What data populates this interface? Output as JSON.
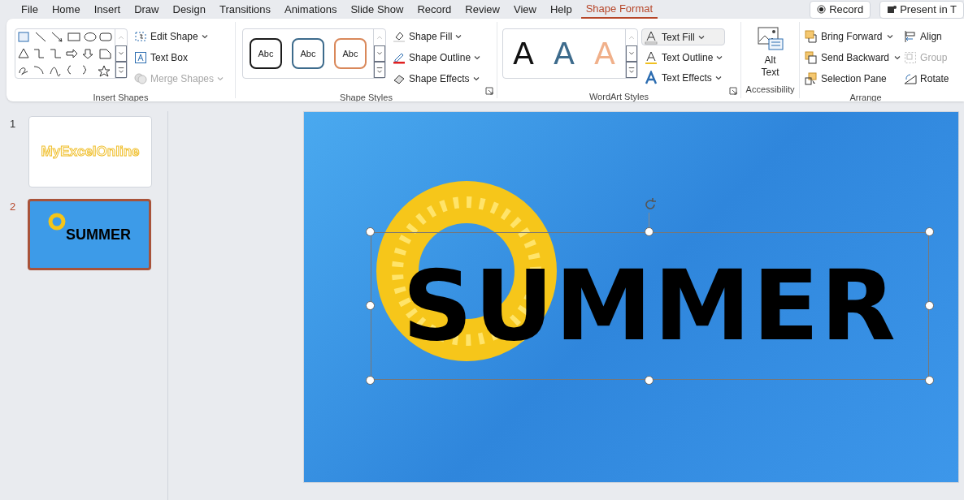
{
  "menu_tabs": [
    {
      "label": "File",
      "selected": false
    },
    {
      "label": "Home",
      "selected": false
    },
    {
      "label": "Insert",
      "selected": false
    },
    {
      "label": "Draw",
      "selected": false
    },
    {
      "label": "Design",
      "selected": false
    },
    {
      "label": "Transitions",
      "selected": false
    },
    {
      "label": "Animations",
      "selected": false
    },
    {
      "label": "Slide Show",
      "selected": false
    },
    {
      "label": "Record",
      "selected": false
    },
    {
      "label": "Review",
      "selected": false
    },
    {
      "label": "View",
      "selected": false
    },
    {
      "label": "Help",
      "selected": false
    },
    {
      "label": "Shape Format",
      "selected": true
    }
  ],
  "header_buttons": [
    {
      "kind": "record",
      "label": "Record"
    },
    {
      "kind": "present",
      "label": "Present in T"
    }
  ],
  "insert_shapes": {
    "label": "Insert Shapes",
    "commands": [
      {
        "kind": "edit",
        "label": "Edit Shape",
        "dropdown": true,
        "disabled": false
      },
      {
        "kind": "textbox",
        "label": "Text Box",
        "dropdown": false,
        "disabled": false
      },
      {
        "kind": "merge",
        "label": "Merge Shapes",
        "dropdown": true,
        "disabled": true
      }
    ]
  },
  "shape_styles": {
    "label": "Shape Styles",
    "presets": [
      {
        "label": "Abc",
        "color": "#1a1a1a"
      },
      {
        "label": "Abc",
        "color": "#3d6b8c"
      },
      {
        "label": "Abc",
        "color": "#d9885a"
      }
    ],
    "commands": [
      {
        "kind": "fill",
        "label": "Shape Fill"
      },
      {
        "kind": "outline",
        "label": "Shape Outline"
      },
      {
        "kind": "effects",
        "label": "Shape Effects"
      }
    ]
  },
  "wordart_styles": {
    "label": "WordArt Styles",
    "presets": [
      {
        "label": "A",
        "color": "#111111"
      },
      {
        "label": "A",
        "color": "#3d6b8c"
      },
      {
        "label": "A",
        "color": "#f0b08a"
      }
    ],
    "commands": [
      {
        "kind": "fill",
        "label": "Text Fill",
        "selected": true
      },
      {
        "kind": "outline",
        "label": "Text Outline",
        "selected": false
      },
      {
        "kind": "effects",
        "label": "Text Effects",
        "selected": false
      }
    ]
  },
  "accessibility": {
    "label": "Accessibility",
    "command": {
      "line1": "Alt",
      "line2": "Text"
    }
  },
  "arrange": {
    "label": "Arrange",
    "commands": [
      {
        "kind": "forward",
        "label": "Bring Forward",
        "dropdown": true,
        "disabled": false
      },
      {
        "kind": "backward",
        "label": "Send Backward",
        "dropdown": true,
        "disabled": false
      },
      {
        "kind": "pane",
        "label": "Selection Pane",
        "dropdown": false,
        "disabled": false
      }
    ],
    "side_commands": [
      {
        "kind": "align",
        "label": "Align",
        "disabled": false
      },
      {
        "kind": "group",
        "label": "Group",
        "disabled": true
      },
      {
        "kind": "rotate",
        "label": "Rotate",
        "disabled": false
      }
    ]
  },
  "slides": [
    {
      "number": "1",
      "selected": false,
      "kind": "title",
      "text": "MyExcelOnline"
    },
    {
      "number": "2",
      "selected": true,
      "kind": "picture",
      "text": "SUMMER"
    }
  ],
  "canvas": {
    "text": "SUMMER",
    "selected": true
  }
}
